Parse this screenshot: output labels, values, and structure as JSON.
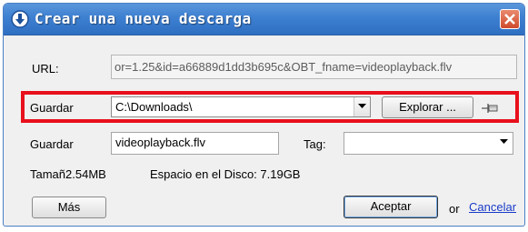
{
  "window": {
    "title": "Crear una nueva descarga",
    "icon": "download-arrow-icon",
    "close_icon": "close-icon"
  },
  "url": {
    "label": "URL:",
    "value": "or=1.25&id=a66889d1dd3b695c&OBT_fname=videoplayback.flv"
  },
  "save_folder": {
    "label": "Guardar",
    "value": "C:\\Downloads\\",
    "browse_label": "Explorar ...",
    "pin_icon": "pin-icon"
  },
  "save_name": {
    "label": "Guardar",
    "value": "videoplayback.flv",
    "tag_label": "Tag:",
    "tag_value": ""
  },
  "info": {
    "size": "Tamañ2.54MB",
    "disk_space": "Espacio en el Disco: 7.19GB"
  },
  "buttons": {
    "more": "Más",
    "accept": "Aceptar",
    "or_text": "or",
    "cancel": "Cancelar"
  },
  "colors": {
    "title_bar": "#3d7fd0",
    "highlight": "#e8101c",
    "link": "#1a3cc9"
  }
}
